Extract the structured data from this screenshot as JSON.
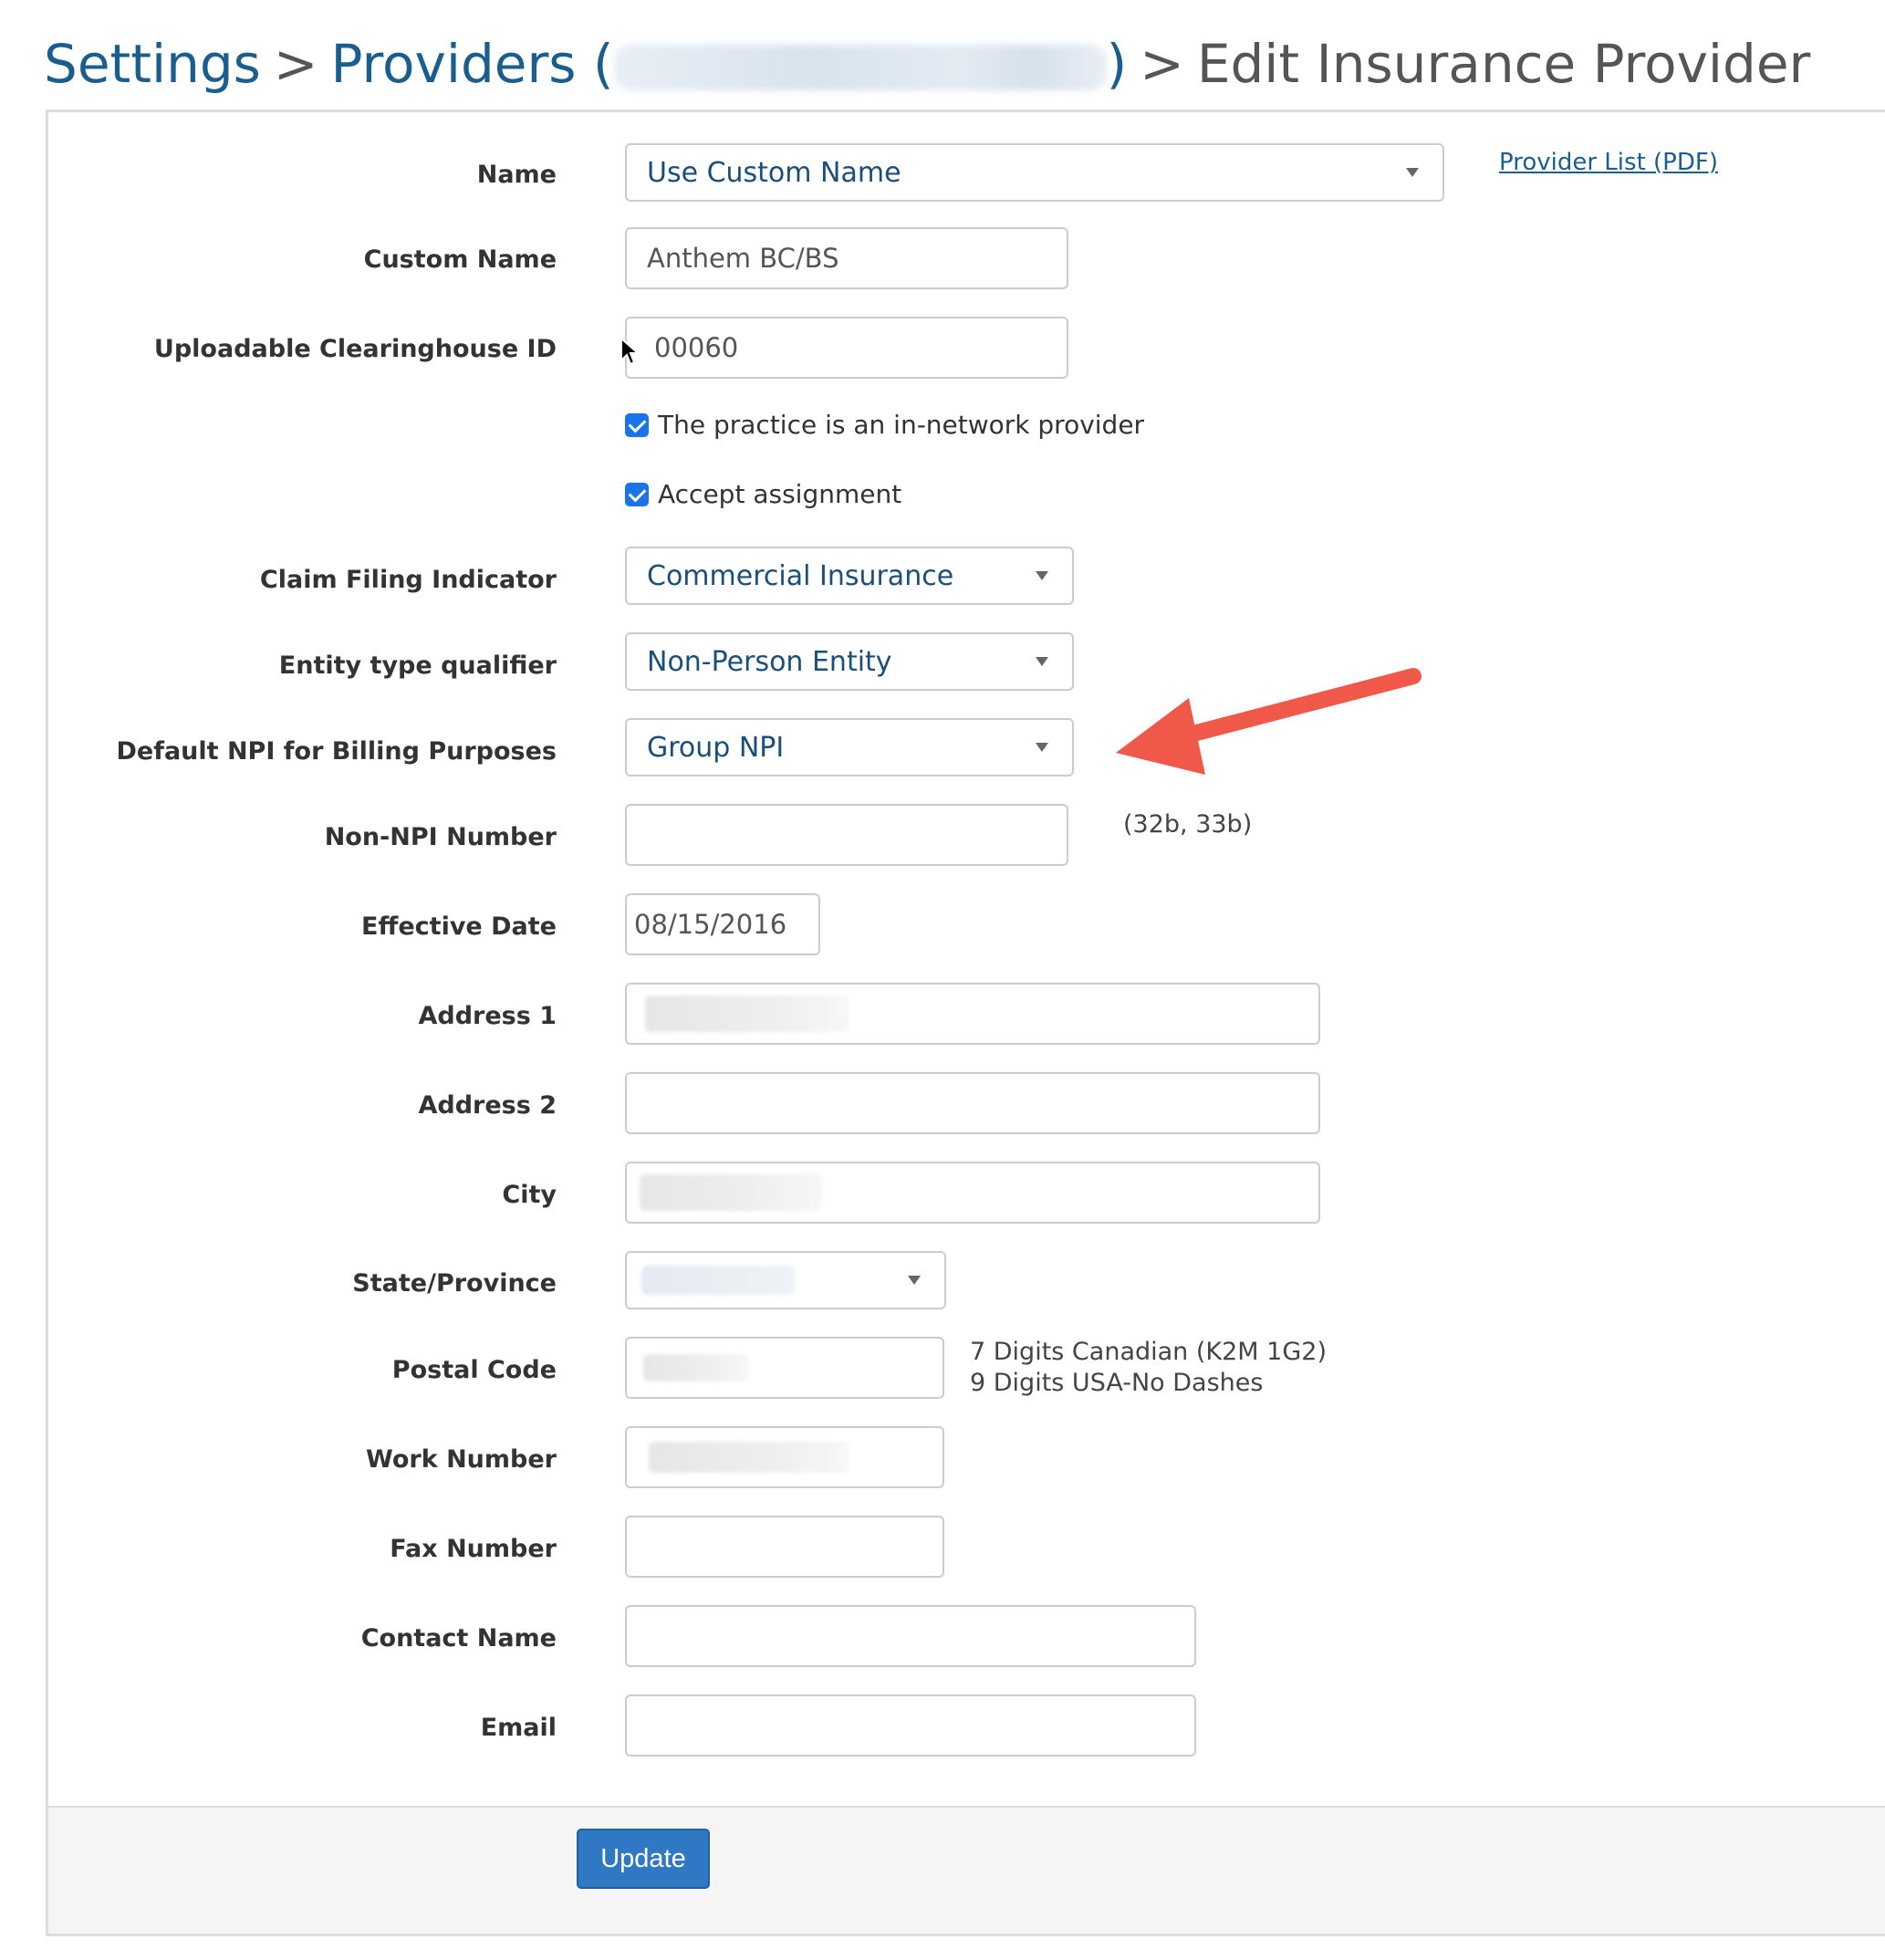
{
  "breadcrumb": {
    "settings": "Settings",
    "providers_prefix": "Providers (",
    "providers_suffix": ")",
    "separator": ">",
    "current": "Edit Insurance Provider"
  },
  "provider_list_link": "Provider List (PDF)",
  "form": {
    "name": {
      "label": "Name",
      "value": "Use Custom Name"
    },
    "custom_name": {
      "label": "Custom Name",
      "value": "Anthem BC/BS"
    },
    "clearinghouse_id": {
      "label": "Uploadable Clearinghouse ID",
      "value": "00060"
    },
    "in_network": {
      "label": "The practice is an in-network provider",
      "checked": true
    },
    "accept_assignment": {
      "label": "Accept assignment",
      "checked": true
    },
    "claim_filing": {
      "label": "Claim Filing Indicator",
      "value": "Commercial Insurance"
    },
    "entity_type": {
      "label": "Entity type qualifier",
      "value": "Non-Person Entity"
    },
    "default_npi": {
      "label": "Default NPI for Billing Purposes",
      "value": "Group NPI"
    },
    "non_npi": {
      "label": "Non-NPI Number",
      "value": "",
      "hint": "(32b, 33b)"
    },
    "effective_date": {
      "label": "Effective Date",
      "value": "08/15/2016"
    },
    "address1": {
      "label": "Address 1"
    },
    "address2": {
      "label": "Address 2",
      "value": ""
    },
    "city": {
      "label": "City"
    },
    "state": {
      "label": "State/Province"
    },
    "postal_code": {
      "label": "Postal Code",
      "hint_line1": "7 Digits Canadian (K2M 1G2)",
      "hint_line2": "9 Digits USA-No Dashes"
    },
    "work_number": {
      "label": "Work Number"
    },
    "fax_number": {
      "label": "Fax Number",
      "value": ""
    },
    "contact_name": {
      "label": "Contact Name",
      "value": ""
    },
    "email": {
      "label": "Email",
      "value": ""
    }
  },
  "update_button": "Update",
  "colors": {
    "link_blue": "#1a5e8f",
    "button_blue": "#2f78c4",
    "annotation_arrow": "#f0584a",
    "checkbox_blue": "#1a73e8"
  }
}
